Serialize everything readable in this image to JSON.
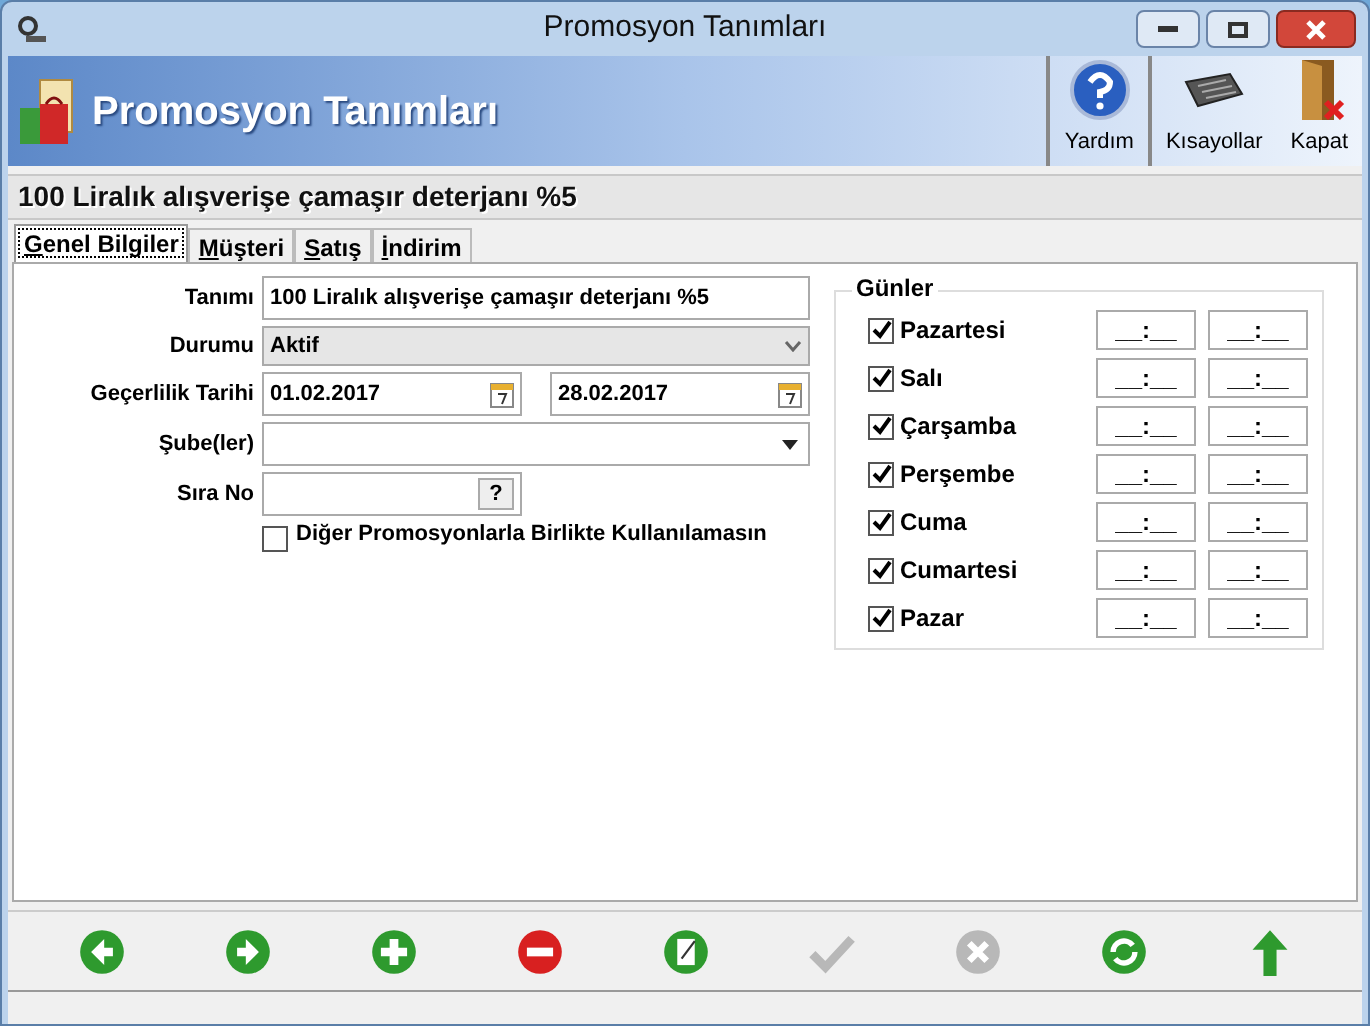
{
  "window": {
    "title": "Promosyon Tanımları"
  },
  "header": {
    "title": "Promosyon Tanımları",
    "actions": [
      {
        "kind": "help",
        "label": "Yardım"
      },
      {
        "kind": "keyboard",
        "label": "Kısayollar"
      },
      {
        "kind": "exit",
        "label": "Kapat"
      }
    ]
  },
  "record_title": "100 Liralık alışverişe çamaşır deterjanı %5",
  "tabs": [
    {
      "label": "Genel Bilgiler",
      "selected": true
    },
    {
      "label": "Müşteri",
      "selected": false
    },
    {
      "label": "Satış",
      "selected": false
    },
    {
      "label": "İndirim",
      "selected": false
    }
  ],
  "form": {
    "tanim": {
      "label": "Tanımı",
      "value": "100 Liralık alışverişe çamaşır deterjanı %5"
    },
    "durum": {
      "label": "Durumu",
      "value": "Aktif"
    },
    "tarih": {
      "label": "Geçerlilik Tarihi",
      "start": "01.02.2017",
      "end": "28.02.2017"
    },
    "sube": {
      "label": "Şube(ler)"
    },
    "sira": {
      "label": "Sıra No",
      "button": "?"
    },
    "exclusive": {
      "label": "Diğer Promosyonlarla Birlikte Kullanılamasın",
      "checked": false
    }
  },
  "days": {
    "title": "Günler",
    "items": [
      {
        "label": "Pazartesi",
        "checked": true,
        "from": "__:__",
        "to": "__:__"
      },
      {
        "label": "Salı",
        "checked": true,
        "from": "__:__",
        "to": "__:__"
      },
      {
        "label": "Çarşamba",
        "checked": true,
        "from": "__:__",
        "to": "__:__"
      },
      {
        "label": "Perşembe",
        "checked": true,
        "from": "__:__",
        "to": "__:__"
      },
      {
        "label": "Cuma",
        "checked": true,
        "from": "__:__",
        "to": "__:__"
      },
      {
        "label": "Cumartesi",
        "checked": true,
        "from": "__:__",
        "to": "__:__"
      },
      {
        "label": "Pazar",
        "checked": true,
        "from": "__:__",
        "to": "__:__"
      }
    ]
  },
  "toolbar": [
    {
      "kind": "prev",
      "disabled": false
    },
    {
      "kind": "next",
      "disabled": false
    },
    {
      "kind": "add",
      "disabled": false
    },
    {
      "kind": "delete",
      "disabled": false
    },
    {
      "kind": "edit",
      "disabled": false
    },
    {
      "kind": "save",
      "disabled": true
    },
    {
      "kind": "cancel",
      "disabled": true
    },
    {
      "kind": "refresh",
      "disabled": false
    },
    {
      "kind": "up",
      "disabled": false
    }
  ]
}
